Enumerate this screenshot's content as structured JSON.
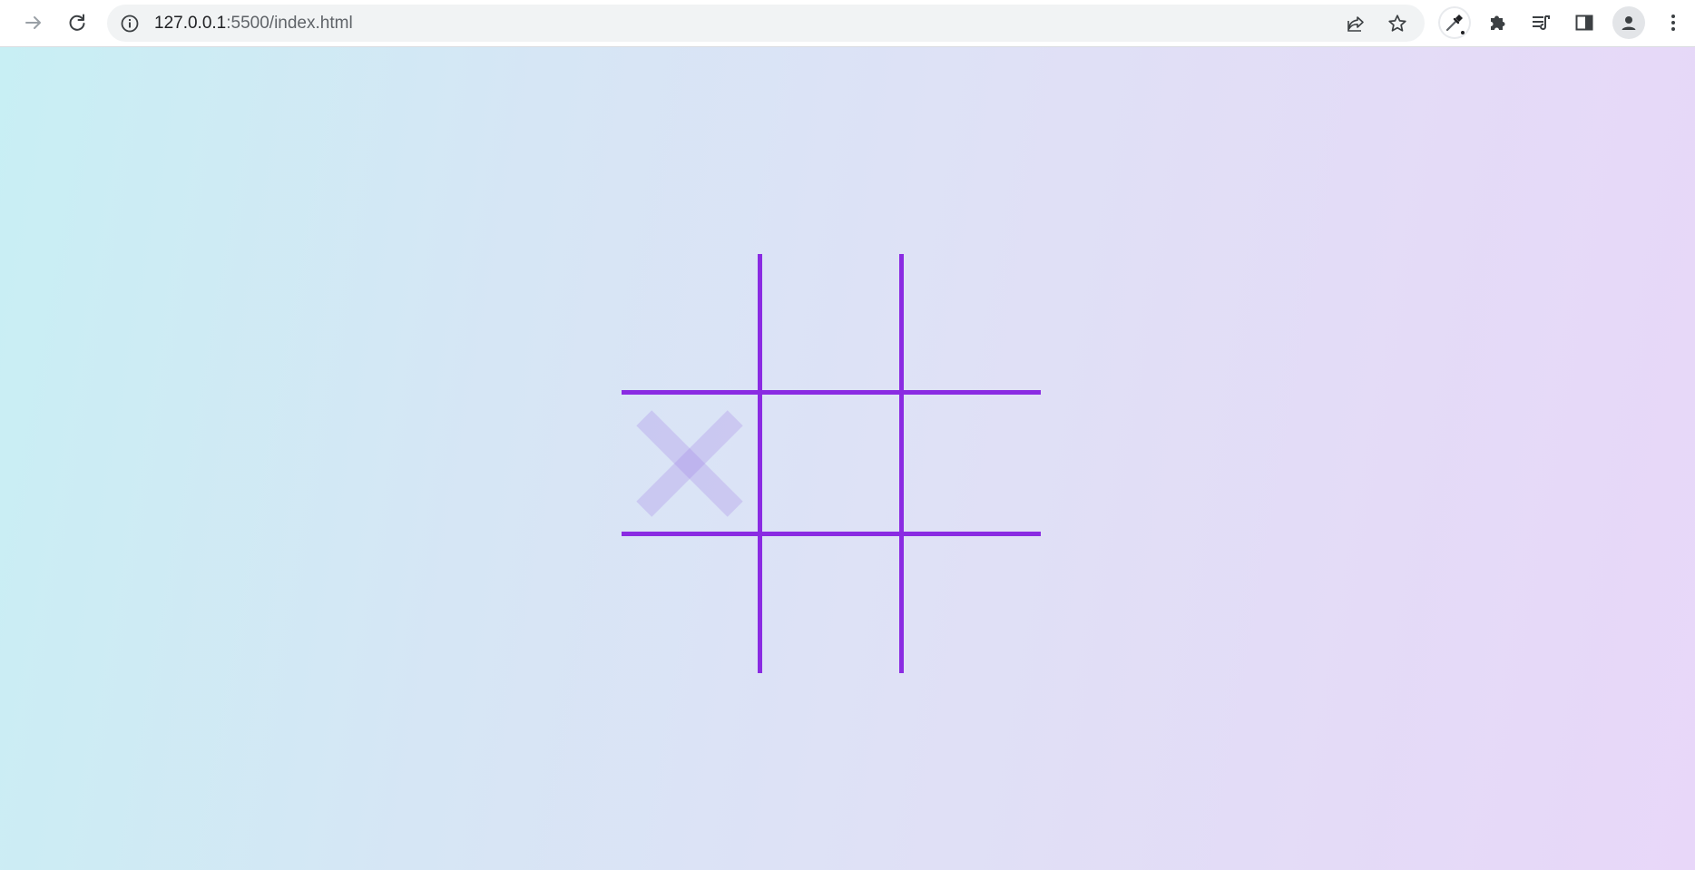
{
  "browser": {
    "url_host": "127.0.0.1",
    "url_path": ":5500/index.html",
    "icons": {
      "forward": "arrow-right-icon",
      "reload": "reload-icon",
      "site_info": "info-icon",
      "share": "share-icon",
      "bookmark": "star-icon",
      "color_picker": "eyedropper-icon",
      "extensions": "puzzle-icon",
      "media": "queue-music-icon",
      "side_panel": "side-panel-icon",
      "profile": "avatar-icon",
      "menu": "kebab-menu-icon"
    }
  },
  "game": {
    "board": [
      [
        "",
        "",
        ""
      ],
      [
        "X",
        "",
        ""
      ],
      [
        "",
        "",
        ""
      ]
    ],
    "hover_preview": {
      "row": 1,
      "col": 0,
      "mark": "X"
    },
    "colors": {
      "grid": "#8a2be2",
      "preview_mark": "#a180e6",
      "background_start": "#c8eff4",
      "background_end": "#e8d7f9"
    }
  }
}
